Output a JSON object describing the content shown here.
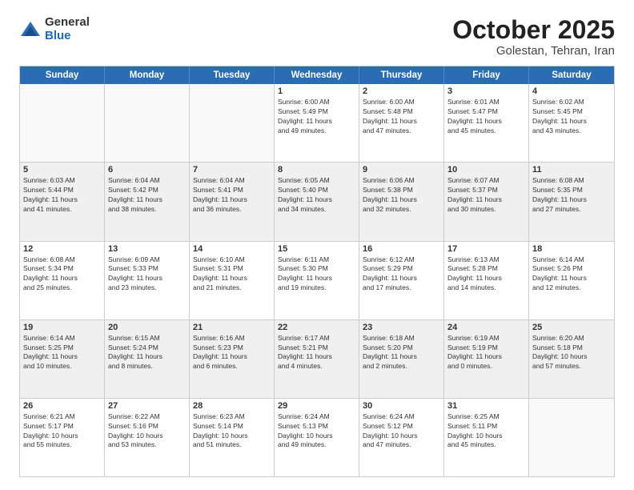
{
  "logo": {
    "general": "General",
    "blue": "Blue"
  },
  "header": {
    "month": "October 2025",
    "location": "Golestan, Tehran, Iran"
  },
  "weekdays": [
    "Sunday",
    "Monday",
    "Tuesday",
    "Wednesday",
    "Thursday",
    "Friday",
    "Saturday"
  ],
  "weeks": [
    [
      {
        "day": "",
        "info": ""
      },
      {
        "day": "",
        "info": ""
      },
      {
        "day": "",
        "info": ""
      },
      {
        "day": "1",
        "info": "Sunrise: 6:00 AM\nSunset: 5:49 PM\nDaylight: 11 hours\nand 49 minutes."
      },
      {
        "day": "2",
        "info": "Sunrise: 6:00 AM\nSunset: 5:48 PM\nDaylight: 11 hours\nand 47 minutes."
      },
      {
        "day": "3",
        "info": "Sunrise: 6:01 AM\nSunset: 5:47 PM\nDaylight: 11 hours\nand 45 minutes."
      },
      {
        "day": "4",
        "info": "Sunrise: 6:02 AM\nSunset: 5:45 PM\nDaylight: 11 hours\nand 43 minutes."
      }
    ],
    [
      {
        "day": "5",
        "info": "Sunrise: 6:03 AM\nSunset: 5:44 PM\nDaylight: 11 hours\nand 41 minutes."
      },
      {
        "day": "6",
        "info": "Sunrise: 6:04 AM\nSunset: 5:42 PM\nDaylight: 11 hours\nand 38 minutes."
      },
      {
        "day": "7",
        "info": "Sunrise: 6:04 AM\nSunset: 5:41 PM\nDaylight: 11 hours\nand 36 minutes."
      },
      {
        "day": "8",
        "info": "Sunrise: 6:05 AM\nSunset: 5:40 PM\nDaylight: 11 hours\nand 34 minutes."
      },
      {
        "day": "9",
        "info": "Sunrise: 6:06 AM\nSunset: 5:38 PM\nDaylight: 11 hours\nand 32 minutes."
      },
      {
        "day": "10",
        "info": "Sunrise: 6:07 AM\nSunset: 5:37 PM\nDaylight: 11 hours\nand 30 minutes."
      },
      {
        "day": "11",
        "info": "Sunrise: 6:08 AM\nSunset: 5:35 PM\nDaylight: 11 hours\nand 27 minutes."
      }
    ],
    [
      {
        "day": "12",
        "info": "Sunrise: 6:08 AM\nSunset: 5:34 PM\nDaylight: 11 hours\nand 25 minutes."
      },
      {
        "day": "13",
        "info": "Sunrise: 6:09 AM\nSunset: 5:33 PM\nDaylight: 11 hours\nand 23 minutes."
      },
      {
        "day": "14",
        "info": "Sunrise: 6:10 AM\nSunset: 5:31 PM\nDaylight: 11 hours\nand 21 minutes."
      },
      {
        "day": "15",
        "info": "Sunrise: 6:11 AM\nSunset: 5:30 PM\nDaylight: 11 hours\nand 19 minutes."
      },
      {
        "day": "16",
        "info": "Sunrise: 6:12 AM\nSunset: 5:29 PM\nDaylight: 11 hours\nand 17 minutes."
      },
      {
        "day": "17",
        "info": "Sunrise: 6:13 AM\nSunset: 5:28 PM\nDaylight: 11 hours\nand 14 minutes."
      },
      {
        "day": "18",
        "info": "Sunrise: 6:14 AM\nSunset: 5:26 PM\nDaylight: 11 hours\nand 12 minutes."
      }
    ],
    [
      {
        "day": "19",
        "info": "Sunrise: 6:14 AM\nSunset: 5:25 PM\nDaylight: 11 hours\nand 10 minutes."
      },
      {
        "day": "20",
        "info": "Sunrise: 6:15 AM\nSunset: 5:24 PM\nDaylight: 11 hours\nand 8 minutes."
      },
      {
        "day": "21",
        "info": "Sunrise: 6:16 AM\nSunset: 5:23 PM\nDaylight: 11 hours\nand 6 minutes."
      },
      {
        "day": "22",
        "info": "Sunrise: 6:17 AM\nSunset: 5:21 PM\nDaylight: 11 hours\nand 4 minutes."
      },
      {
        "day": "23",
        "info": "Sunrise: 6:18 AM\nSunset: 5:20 PM\nDaylight: 11 hours\nand 2 minutes."
      },
      {
        "day": "24",
        "info": "Sunrise: 6:19 AM\nSunset: 5:19 PM\nDaylight: 11 hours\nand 0 minutes."
      },
      {
        "day": "25",
        "info": "Sunrise: 6:20 AM\nSunset: 5:18 PM\nDaylight: 10 hours\nand 57 minutes."
      }
    ],
    [
      {
        "day": "26",
        "info": "Sunrise: 6:21 AM\nSunset: 5:17 PM\nDaylight: 10 hours\nand 55 minutes."
      },
      {
        "day": "27",
        "info": "Sunrise: 6:22 AM\nSunset: 5:16 PM\nDaylight: 10 hours\nand 53 minutes."
      },
      {
        "day": "28",
        "info": "Sunrise: 6:23 AM\nSunset: 5:14 PM\nDaylight: 10 hours\nand 51 minutes."
      },
      {
        "day": "29",
        "info": "Sunrise: 6:24 AM\nSunset: 5:13 PM\nDaylight: 10 hours\nand 49 minutes."
      },
      {
        "day": "30",
        "info": "Sunrise: 6:24 AM\nSunset: 5:12 PM\nDaylight: 10 hours\nand 47 minutes."
      },
      {
        "day": "31",
        "info": "Sunrise: 6:25 AM\nSunset: 5:11 PM\nDaylight: 10 hours\nand 45 minutes."
      },
      {
        "day": "",
        "info": ""
      }
    ]
  ]
}
